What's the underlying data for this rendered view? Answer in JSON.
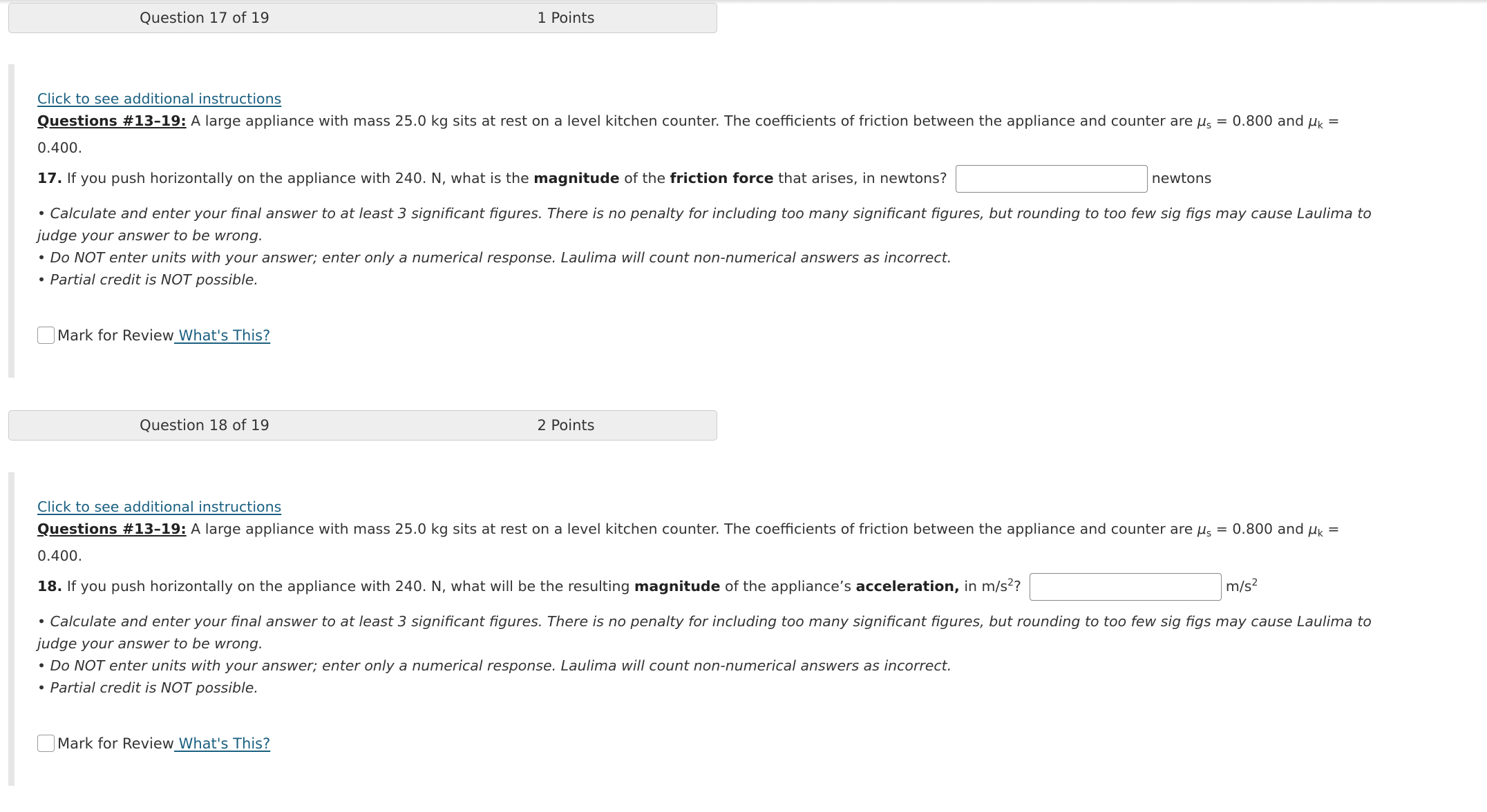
{
  "questions": [
    {
      "header": {
        "number_label": "Question 17 of 19",
        "points_label": "1 Points"
      },
      "instructions_link": "Click to see additional instructions",
      "intro": {
        "label": "Questions #13–19:",
        "text_before_mu_s": " A large appliance with mass 25.0 kg sits at rest on a level kitchen counter.  The coefficients of friction between the appliance and counter are ",
        "mu_symbol": "μ",
        "mu_s_sub": "s",
        "mu_s_value": " = 0.800 and ",
        "mu_k_sub": "k",
        "mu_k_value": " = 0.400."
      },
      "prompt": {
        "number": "17.",
        "text_1": " If you push horizontally on the appliance with 240. N, what is the ",
        "bold_1": "magnitude",
        "text_2": " of the ",
        "bold_2": "friction force",
        "text_3": " that arises, in newtons?",
        "answer_value": "",
        "unit": "newtons"
      },
      "notes": [
        " • Calculate and enter your final answer to at least 3 significant figures.  There is no penalty for including too many significant figures, but rounding to too few sig figs may cause Laulima to judge your answer to be wrong.",
        "• Do NOT enter units with your answer; enter only a numerical response.  Laulima will count non-numerical answers as incorrect.",
        "• Partial credit is NOT possible."
      ],
      "mark_for_review": {
        "label": "Mark for Review",
        "checked": false,
        "help_link": " What's This?"
      }
    },
    {
      "header": {
        "number_label": "Question 18 of 19",
        "points_label": "2 Points"
      },
      "instructions_link": "Click to see additional instructions",
      "intro": {
        "label": "Questions #13–19:",
        "text_before_mu_s": " A large appliance with mass 25.0 kg sits at rest on a level kitchen counter.  The coefficients of friction between the appliance and counter are ",
        "mu_symbol": "μ",
        "mu_s_sub": "s",
        "mu_s_value": " = 0.800 and ",
        "mu_k_sub": "k",
        "mu_k_value": " = 0.400."
      },
      "prompt": {
        "number": "18.",
        "text_1": " If you push horizontally on the appliance with 240. N, what will be the resulting ",
        "bold_1": "magnitude",
        "text_2": " of the appliance’s ",
        "bold_2": "acceleration,",
        "text_3": " in m/s",
        "text_3_sup": "2",
        "text_3_end": "?",
        "answer_value": "",
        "unit": "m/s",
        "unit_sup": "2"
      },
      "notes": [
        " • Calculate and enter your final answer to at least 3 significant figures.  There is no penalty for including too many significant figures, but rounding to too few sig figs may cause Laulima to judge your answer to be wrong.",
        "• Do NOT enter units with your answer; enter only a numerical response.  Laulima will count non-numerical answers as incorrect.",
        "• Partial credit is NOT possible."
      ],
      "mark_for_review": {
        "label": "Mark for Review",
        "checked": false,
        "help_link": " What's This?"
      }
    }
  ]
}
